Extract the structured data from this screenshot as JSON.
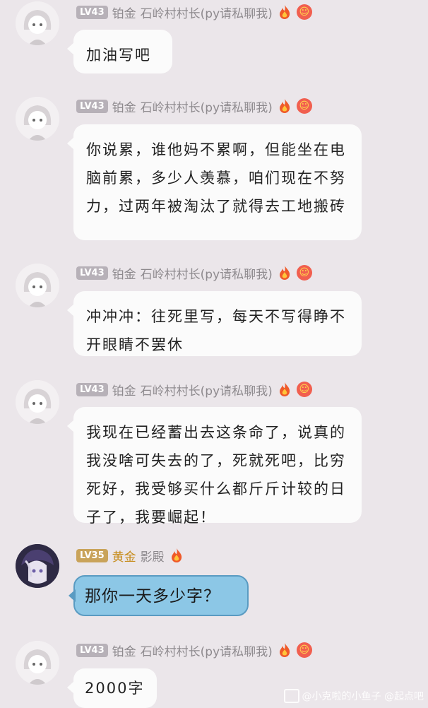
{
  "messages": [
    {
      "level": "LV43",
      "rank": "铂金",
      "nickname": "石岭村村长(py请私聊我)",
      "text": "加油写吧"
    },
    {
      "level": "LV43",
      "rank": "铂金",
      "nickname": "石岭村村长(py请私聊我)",
      "text": "你说累，谁他妈不累啊，但能坐在电脑前累，多少人羡慕，咱们现在不努力，过两年被淘汰了就得去工地搬砖"
    },
    {
      "level": "LV43",
      "rank": "铂金",
      "nickname": "石岭村村长(py请私聊我)",
      "text": "冲冲冲：往死里写，每天不写得睁不开眼睛不罢休"
    },
    {
      "level": "LV43",
      "rank": "铂金",
      "nickname": "石岭村村长(py请私聊我)",
      "text": "我现在已经蓄出去这条命了，说真的我没啥可失去的了，死就死吧，比穷死好，我受够买什么都斤斤计较的日子了，我要崛起！"
    },
    {
      "level": "LV35",
      "rank": "黄金",
      "nickname": "影殿",
      "text": "那你一天多少字？"
    },
    {
      "level": "LV43",
      "rank": "铂金",
      "nickname": "石岭村村长(py请私聊我)",
      "text": "2000字"
    }
  ],
  "watermark": {
    "text": "@小克啦的小鱼子 @起点吧"
  },
  "colors": {
    "background": "#ebe6ea",
    "bubble": "#fbfbfb",
    "special_bubble": "#8cc7e6"
  }
}
